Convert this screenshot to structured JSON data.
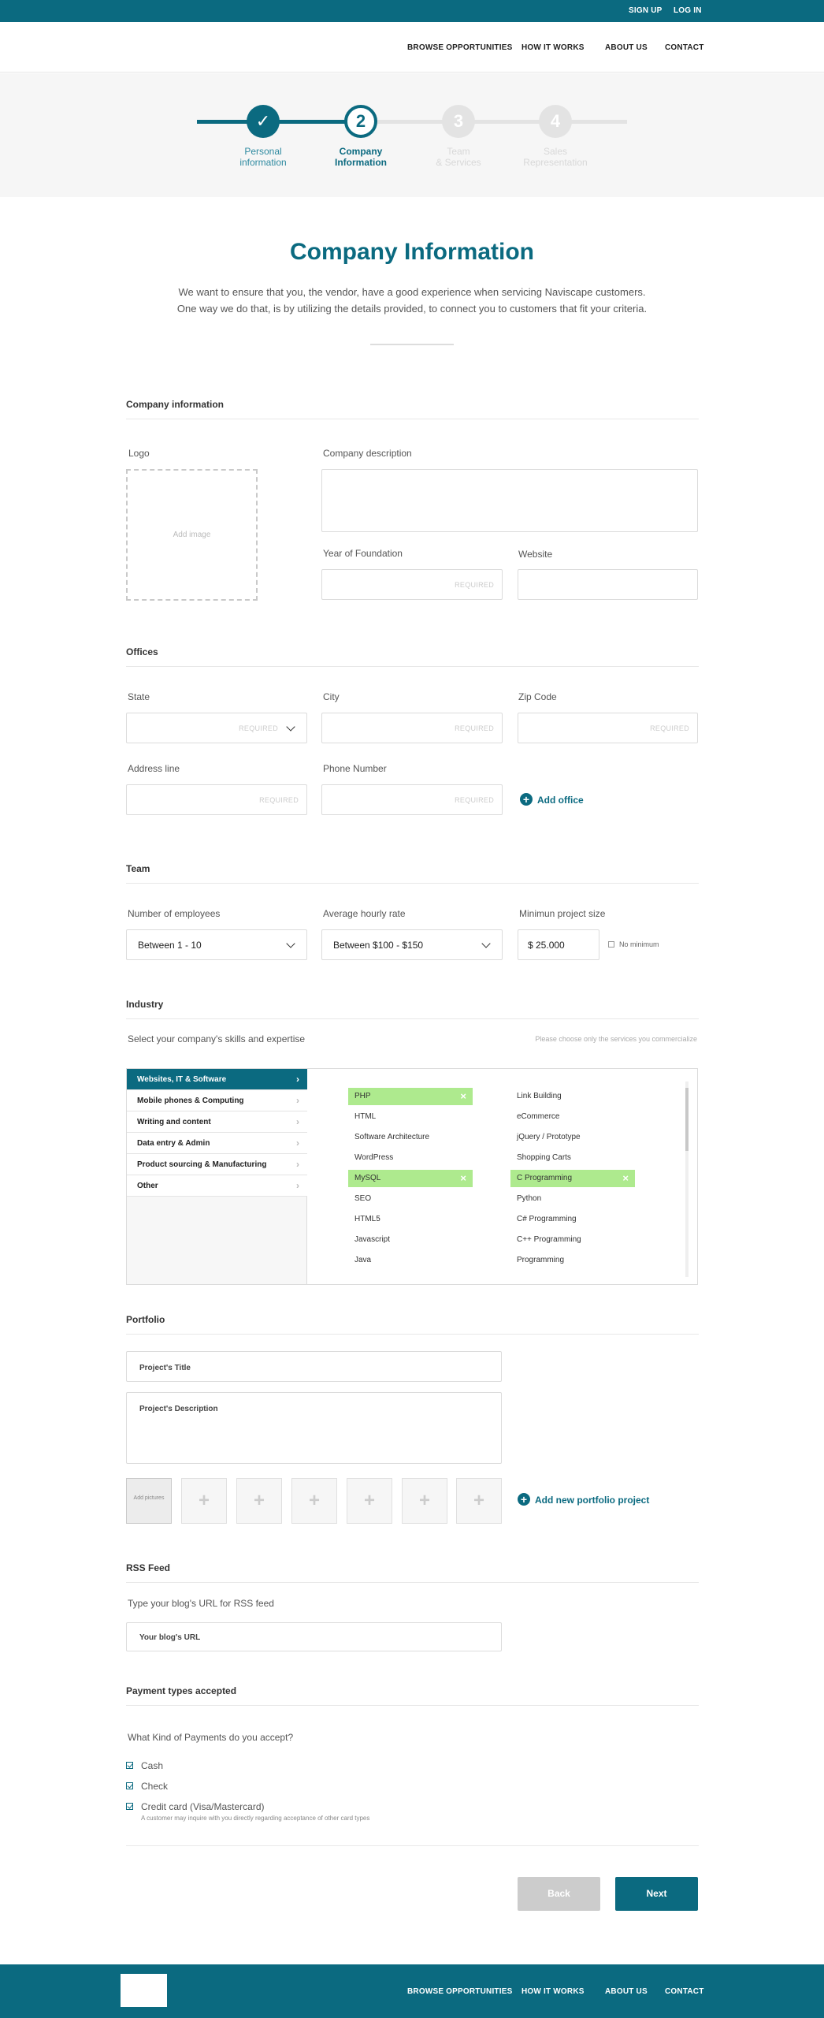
{
  "topbar": {
    "signup": "SIGN UP",
    "login": "LOG IN"
  },
  "nav": {
    "browse": "BROWSE OPPORTUNITIES",
    "how": "HOW IT WORKS",
    "about": "ABOUT US",
    "contact": "CONTACT"
  },
  "stepper": {
    "steps": [
      {
        "number": "✓",
        "line1": "Personal",
        "line2": "information"
      },
      {
        "number": "2",
        "line1": "Company",
        "line2": "Information"
      },
      {
        "number": "3",
        "line1": "Team",
        "line2": "& Services"
      },
      {
        "number": "4",
        "line1": "Sales",
        "line2": "Representation"
      }
    ],
    "colors": {
      "active": "#0b6a80",
      "inactive": "#e3e3e3"
    }
  },
  "hero": {
    "title": "Company Information",
    "intro": "We want to ensure that you, the vendor, have a good experience when servicing Naviscape customers. One way we do that, is by utilizing the details provided, to connect you to customers that fit your criteria."
  },
  "company": {
    "section_title": "Company information",
    "logo_label": "Logo",
    "logo_placeholder": "Add image",
    "description_label": "Company description",
    "foundation_label": "Year of Foundation",
    "website_label": "Website",
    "required": "REQUIRED"
  },
  "offices": {
    "section_title": "Offices",
    "state_label": "State",
    "city_label": "City",
    "zip_label": "Zip Code",
    "address_label": "Address line",
    "phone_label": "Phone Number",
    "add_office": "Add office"
  },
  "team": {
    "section_title": "Team",
    "employees_label": "Number of employees",
    "employees_value": "Between 1 - 10",
    "rate_label": "Average hourly rate",
    "rate_value": "Between $100 - $150",
    "min_label": "Minimun project size",
    "min_value": "$ 25.000",
    "no_minimum": "No minimum"
  },
  "industry": {
    "section_title": "Industry",
    "subtitle": "Select your company's skills and expertise",
    "hint": "Please choose only the services you commercialize",
    "categories": [
      "Websites, IT & Software",
      "Mobile phones & Computing",
      "Writing and content",
      "Data entry & Admin",
      "Product sourcing & Manufacturing",
      "Other"
    ],
    "skills_left": [
      "PHP",
      "HTML",
      "Software Architecture",
      "WordPress",
      "MySQL",
      "SEO",
      "HTML5",
      "Javascript",
      "Java"
    ],
    "skills_right": [
      "Link Building",
      "eCommerce",
      "jQuery / Prototype",
      "Shopping Carts",
      "C Programming",
      "Python",
      "C# Programming",
      "C++ Programming",
      "Programming"
    ],
    "selected_color": "#aeea8e"
  },
  "portfolio": {
    "section_title": "Portfolio",
    "title_placeholder": "Project's Title",
    "description_placeholder": "Project's Description",
    "add_pictures": "Add pictures",
    "plus": "+",
    "add_project": "Add new portfolio project"
  },
  "rss": {
    "section_title": "RSS Feed",
    "label": "Type your blog's URL for RSS feed",
    "placeholder": "Your blog's URL"
  },
  "payment": {
    "section_title": "Payment types accepted",
    "question": "What Kind of Payments do you accept?",
    "options": [
      "Cash",
      "Check",
      "Credit card  (Visa/Mastercard)"
    ],
    "note": "A customer may inquire with you directly regarding acceptance of other card types"
  },
  "actions": {
    "back": "Back",
    "next": "Next",
    "back_color": "#cccccc",
    "next_color": "#0b6a80"
  },
  "footer": {
    "browse": "BROWSE OPPORTUNITIES",
    "how": "HOW IT WORKS",
    "about": "ABOUT US",
    "contact": "CONTACT"
  }
}
